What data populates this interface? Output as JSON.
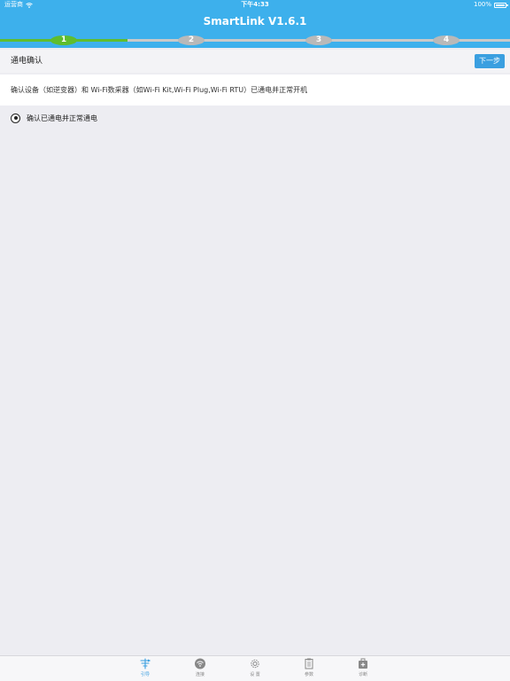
{
  "status_bar": {
    "carrier": "运营商",
    "time": "下午4:33",
    "battery": "100%"
  },
  "nav": {
    "title": "SmartLink V1.6.1"
  },
  "progress": {
    "current_step": 1,
    "steps": [
      "1",
      "2",
      "3",
      "4"
    ],
    "colors": {
      "active": "#5fbd2e",
      "inactive": "#b9b9b9"
    }
  },
  "section": {
    "title": "通电确认",
    "next_label": "下一步"
  },
  "description": "确认设备（如逆变器）和 Wi-Fi数采器（如Wi-Fi Kit,Wi-Fi Plug,Wi-Fi RTU）已通电并正常开机",
  "confirm": {
    "label": "确认已通电并正常通电",
    "checked": true
  },
  "tabs": [
    {
      "label": "引导",
      "icon": "guide-icon",
      "active": true
    },
    {
      "label": "连接",
      "icon": "wifi-icon",
      "active": false
    },
    {
      "label": "设 置",
      "icon": "gear-icon",
      "active": false
    },
    {
      "label": "参数",
      "icon": "clipboard-icon",
      "active": false
    },
    {
      "label": "诊断",
      "icon": "medkit-icon",
      "active": false
    }
  ],
  "colors": {
    "header": "#3db0ec",
    "accent": "#3a9fe0",
    "background": "#ededf2"
  }
}
